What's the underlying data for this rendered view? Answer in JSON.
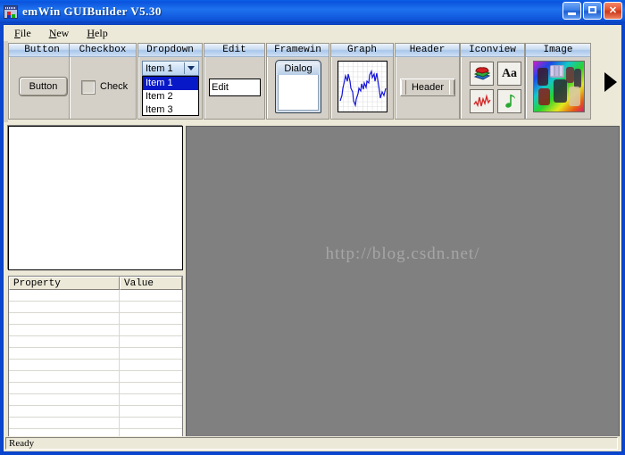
{
  "window": {
    "title": "emWin GUIBuilder V5.30",
    "icon": "app-window-icon",
    "buttons": {
      "minimize": "minimize",
      "maximize": "maximize",
      "close": "close"
    }
  },
  "menubar": {
    "items": [
      {
        "id": "file",
        "accel": "F",
        "rest": "ile"
      },
      {
        "id": "new",
        "accel": "N",
        "rest": "ew"
      },
      {
        "id": "help",
        "accel": "H",
        "rest": "elp"
      }
    ]
  },
  "toolbox": {
    "scroll_right": "scroll-right-arrow",
    "panels": [
      {
        "id": "button",
        "title": "Button",
        "label": "Button"
      },
      {
        "id": "checkbox",
        "title": "Checkbox",
        "label": "Check"
      },
      {
        "id": "dropdown",
        "title": "Dropdown",
        "selected": "Item 1",
        "options": [
          "Item 1",
          "Item 2",
          "Item 3"
        ]
      },
      {
        "id": "edit",
        "title": "Edit",
        "label": "Edit"
      },
      {
        "id": "framewin",
        "title": "Framewin",
        "label": "Dialog"
      },
      {
        "id": "graph",
        "title": "Graph",
        "label": ""
      },
      {
        "id": "header",
        "title": "Header",
        "label": "Header"
      },
      {
        "id": "iconview",
        "title": "Iconview",
        "icons": [
          "books-icon",
          "text-aa-icon",
          "waveform-icon",
          "music-note-icon"
        ],
        "aa_label": "Aa"
      },
      {
        "id": "image",
        "title": "Image",
        "label": ""
      }
    ]
  },
  "properties": {
    "columns": [
      "Property",
      "Value"
    ],
    "rows": [
      [
        "",
        ""
      ],
      [
        "",
        ""
      ],
      [
        "",
        ""
      ],
      [
        "",
        ""
      ],
      [
        "",
        ""
      ],
      [
        "",
        ""
      ],
      [
        "",
        ""
      ],
      [
        "",
        ""
      ],
      [
        "",
        ""
      ],
      [
        "",
        ""
      ],
      [
        "",
        ""
      ],
      [
        "",
        ""
      ],
      [
        "",
        ""
      ]
    ]
  },
  "canvas": {
    "watermark": "http://blog.csdn.net/"
  },
  "statusbar": {
    "text": "Ready"
  },
  "colors": {
    "titlebar_blue": "#1f72ef",
    "panel_face": "#d4d0c8",
    "window_face": "#ece9d8",
    "canvas_gray": "#808080",
    "select_blue": "#0618c8",
    "graph_line": "#1515d8"
  }
}
